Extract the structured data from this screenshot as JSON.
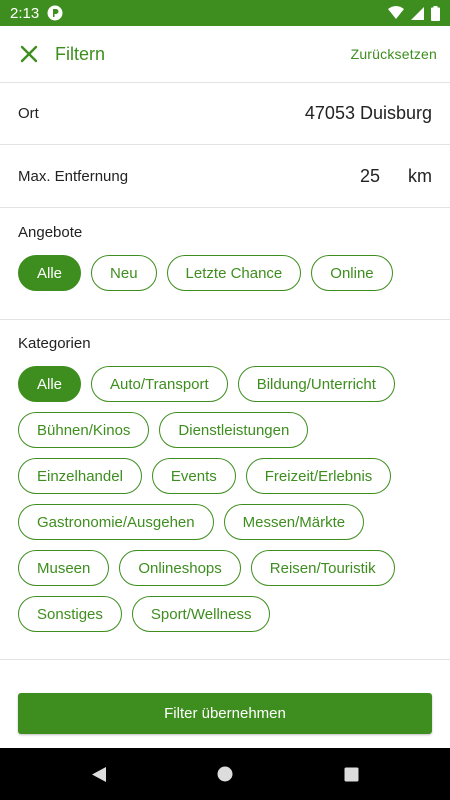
{
  "status_bar": {
    "time": "2:13"
  },
  "header": {
    "title": "Filtern",
    "reset_label": "Zurücksetzen"
  },
  "location": {
    "label": "Ort",
    "value": "47053 Duisburg"
  },
  "distance": {
    "label": "Max. Entfernung",
    "value": "25",
    "unit": "km"
  },
  "offers": {
    "title": "Angebote",
    "chips": [
      {
        "label": "Alle",
        "selected": true
      },
      {
        "label": "Neu",
        "selected": false
      },
      {
        "label": "Letzte Chance",
        "selected": false
      },
      {
        "label": "Online",
        "selected": false
      }
    ]
  },
  "categories": {
    "title": "Kategorien",
    "chips": [
      {
        "label": "Alle",
        "selected": true
      },
      {
        "label": "Auto/Transport",
        "selected": false
      },
      {
        "label": "Bildung/Unterricht",
        "selected": false
      },
      {
        "label": "Bühnen/Kinos",
        "selected": false
      },
      {
        "label": "Dienstleistungen",
        "selected": false
      },
      {
        "label": "Einzelhandel",
        "selected": false
      },
      {
        "label": "Events",
        "selected": false
      },
      {
        "label": "Freizeit/Erlebnis",
        "selected": false
      },
      {
        "label": "Gastronomie/Ausgehen",
        "selected": false
      },
      {
        "label": "Messen/Märkte",
        "selected": false
      },
      {
        "label": "Museen",
        "selected": false
      },
      {
        "label": "Onlineshops",
        "selected": false
      },
      {
        "label": "Reisen/Touristik",
        "selected": false
      },
      {
        "label": "Sonstiges",
        "selected": false
      },
      {
        "label": "Sport/Wellness",
        "selected": false
      }
    ]
  },
  "apply_button": {
    "label": "Filter übernehmen"
  },
  "colors": {
    "accent": "#3e8e1f",
    "divider": "#e3e3e3",
    "nav_bar": "#000000"
  }
}
